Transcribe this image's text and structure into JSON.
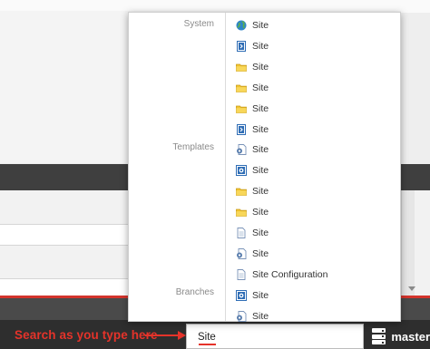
{
  "dropdown": {
    "categories": {
      "system": "System",
      "templates": "Templates",
      "branches": "Branches"
    },
    "items": [
      {
        "label": "Site",
        "icon": "globe-icon"
      },
      {
        "label": "Site",
        "icon": "template-icon"
      },
      {
        "label": "Site",
        "icon": "folder-icon"
      },
      {
        "label": "Site",
        "icon": "folder-icon"
      },
      {
        "label": "Site",
        "icon": "folder-icon"
      },
      {
        "label": "Site",
        "icon": "template-icon"
      },
      {
        "label": "Site",
        "icon": "document-gear-icon"
      },
      {
        "label": "Site",
        "icon": "branch-page-icon"
      },
      {
        "label": "Site",
        "icon": "folder-icon"
      },
      {
        "label": "Site",
        "icon": "folder-icon"
      },
      {
        "label": "Site",
        "icon": "document-icon"
      },
      {
        "label": "Site",
        "icon": "document-gear-icon"
      },
      {
        "label": "Site Configuration",
        "icon": "document-icon"
      },
      {
        "label": "Site",
        "icon": "branch-page-icon"
      },
      {
        "label": "Site",
        "icon": "document-gear-icon"
      }
    ]
  },
  "annotation": {
    "text": "Search as you type here"
  },
  "search": {
    "value": "Site"
  },
  "branch": {
    "label": "master"
  },
  "colors": {
    "accent_red": "#e5332a",
    "statusbar": "#2e2e2e",
    "folder_yellow": "#f3c531",
    "template_blue": "#2f6db5"
  }
}
